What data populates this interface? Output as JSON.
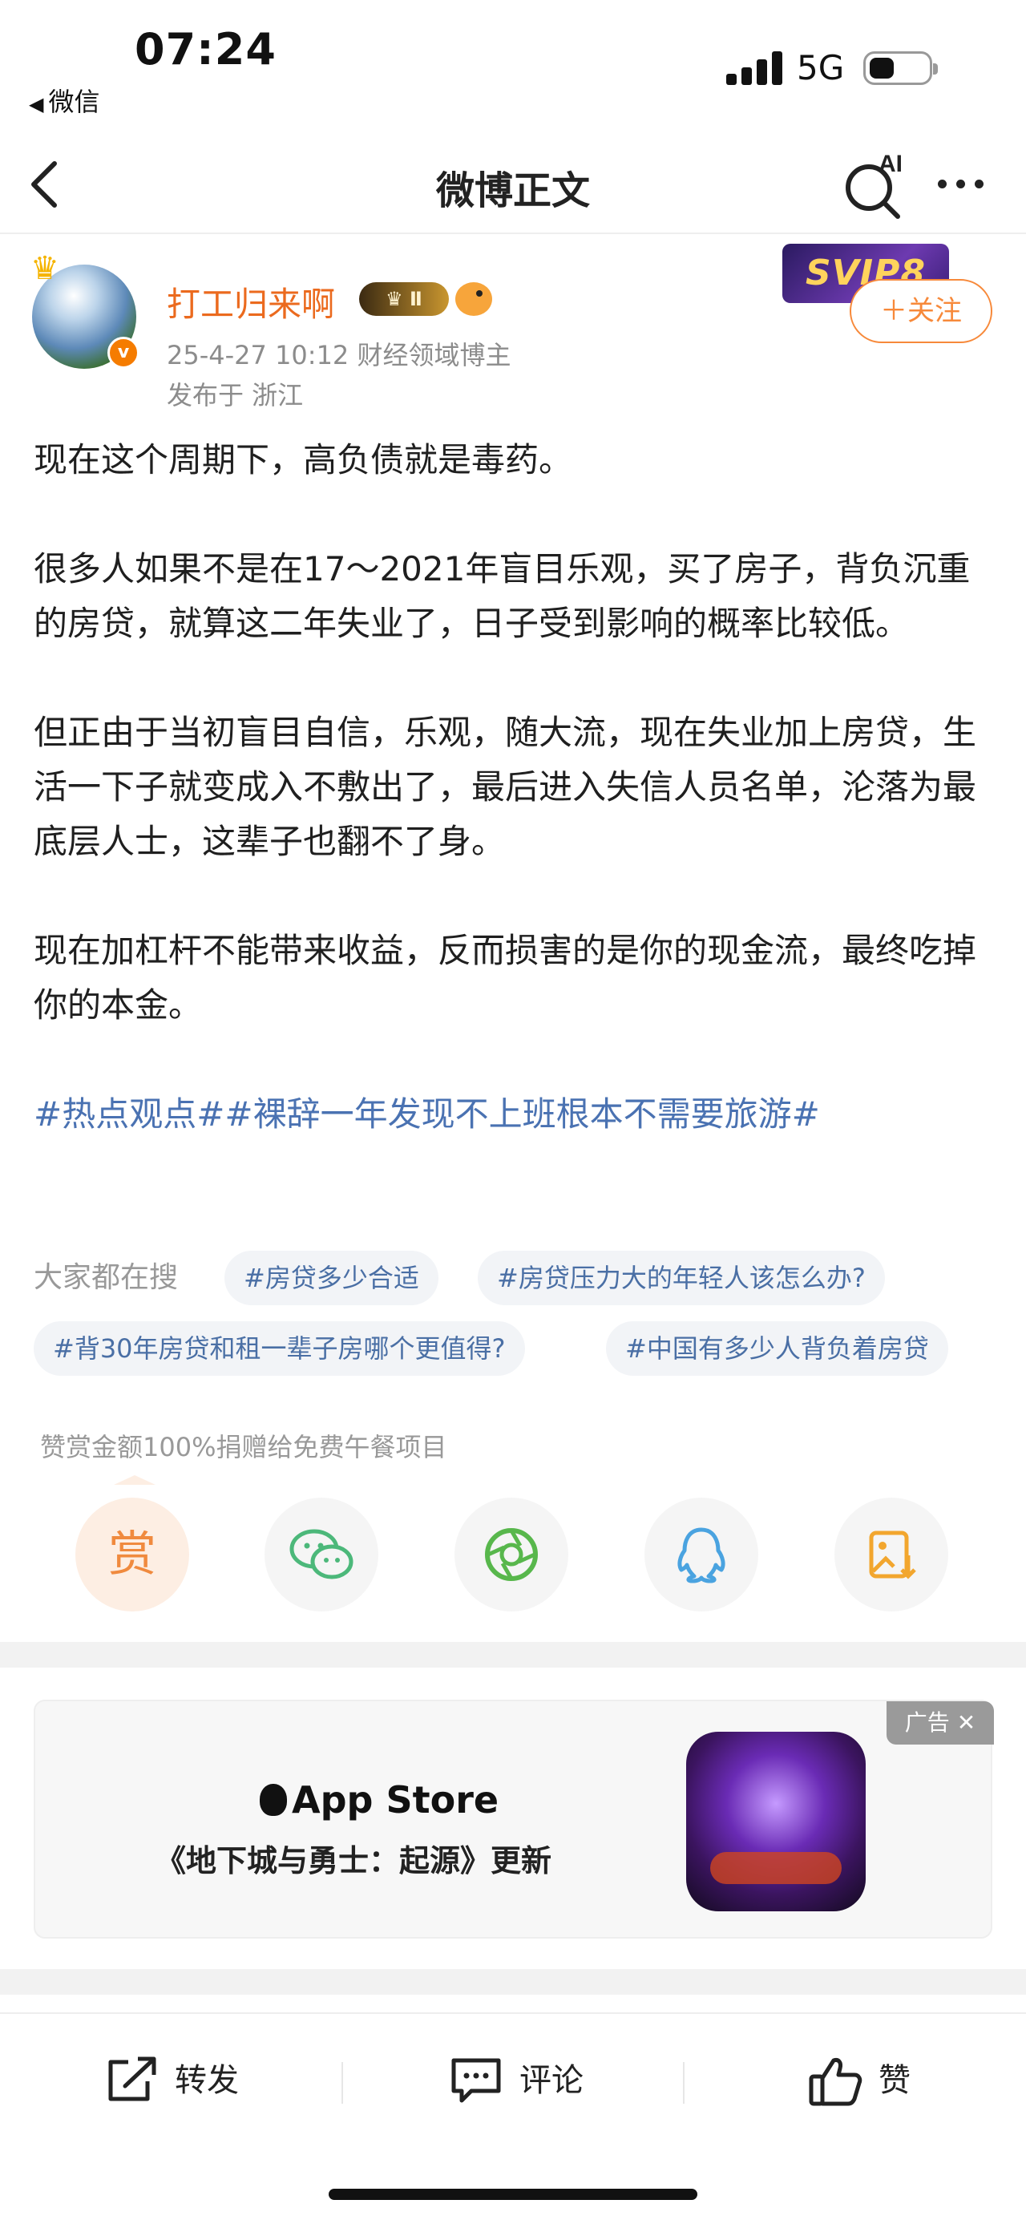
{
  "status_bar": {
    "time": "07:24",
    "back_app": "微信",
    "network": "5G"
  },
  "nav": {
    "title": "微博正文",
    "ai_label": "AI"
  },
  "author": {
    "name": "打工归来啊",
    "level_badge": "Ⅱ",
    "verified_badge": "v",
    "timestamp_and_category": "25-4-27 10:12  财经领域博主",
    "location": "发布于 浙江",
    "svip_badge": "SVIP8",
    "follow_label": "＋关注"
  },
  "post": {
    "paragraph_1": "现在这个周期下，高负债就是毒药。",
    "paragraph_2": "很多人如果不是在17～2021年盲目乐观，买了房子，背负沉重的房贷，就算这二年失业了，日子受到影响的概率比较低。",
    "paragraph_3": "但正由于当初盲目自信，乐观，随大流，现在失业加上房贷，生活一下子就变成入不敷出了，最后进入失信人员名单，沦落为最底层人士，这辈子也翻不了身。",
    "paragraph_4": "现在加杠杆不能带来收益，反而损害的是你的现金流，最终吃掉你的本金。",
    "hashtags": "#热点观点##裸辞一年发现不上班根本不需要旅游#"
  },
  "searches": {
    "label": "大家都在搜",
    "chips": [
      "#房贷多少合适",
      "#房贷压力大的年轻人该怎么办?",
      "#背30年房贷和租一辈子房哪个更值得?",
      "#中国有多少人背负着房贷"
    ]
  },
  "reward": {
    "note": "赞赏金额100%捐赠给免费午餐项目",
    "reward_label": "赏"
  },
  "share_icons": [
    "reward-icon",
    "wechat-icon",
    "moments-icon",
    "qq-icon",
    "save-image-icon"
  ],
  "ad": {
    "store": "App Store",
    "title": "《地下城与勇士：起源》更新",
    "tag": "广告"
  },
  "actions": {
    "repost": "转发",
    "comment": "评论",
    "like": "赞"
  },
  "colors": {
    "accent_orange": "#f7893a",
    "link_blue": "#4a72b2",
    "name_orange": "#eb6a1e"
  }
}
